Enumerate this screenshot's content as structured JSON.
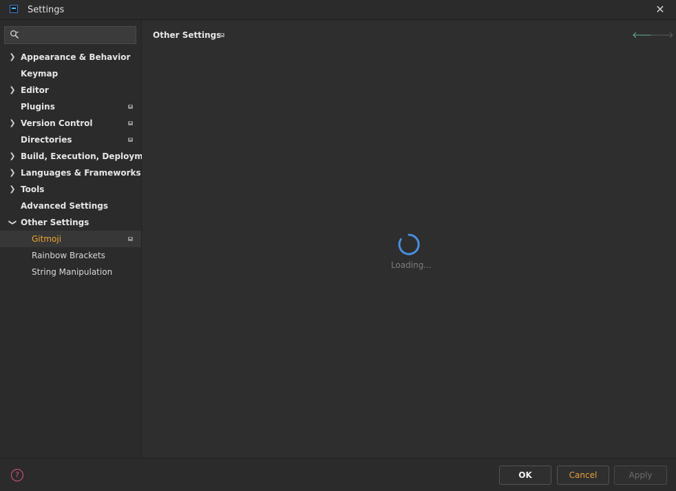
{
  "window": {
    "title": "Settings"
  },
  "search": {
    "placeholder": "",
    "value": ""
  },
  "sidebar": {
    "items": [
      {
        "label": "Appearance & Behavior",
        "expandable": true,
        "expanded": false,
        "badge": false,
        "level": 0
      },
      {
        "label": "Keymap",
        "expandable": false,
        "badge": false,
        "level": 0
      },
      {
        "label": "Editor",
        "expandable": true,
        "expanded": false,
        "badge": false,
        "level": 0
      },
      {
        "label": "Plugins",
        "expandable": false,
        "badge": true,
        "level": 0
      },
      {
        "label": "Version Control",
        "expandable": true,
        "expanded": false,
        "badge": true,
        "level": 0
      },
      {
        "label": "Directories",
        "expandable": false,
        "badge": true,
        "level": 0
      },
      {
        "label": "Build, Execution, Deployment",
        "expandable": true,
        "expanded": false,
        "badge": false,
        "level": 0
      },
      {
        "label": "Languages & Frameworks",
        "expandable": true,
        "expanded": false,
        "badge": false,
        "level": 0
      },
      {
        "label": "Tools",
        "expandable": true,
        "expanded": false,
        "badge": false,
        "level": 0
      },
      {
        "label": "Advanced Settings",
        "expandable": false,
        "badge": false,
        "level": 0
      },
      {
        "label": "Other Settings",
        "expandable": true,
        "expanded": true,
        "badge": false,
        "level": 0
      },
      {
        "label": "Gitmoji",
        "expandable": false,
        "badge": true,
        "level": 1,
        "selected": true
      },
      {
        "label": "Rainbow Brackets",
        "expandable": false,
        "badge": false,
        "level": 1
      },
      {
        "label": "String Manipulation",
        "expandable": false,
        "badge": false,
        "level": 1
      }
    ]
  },
  "main": {
    "breadcrumb": "Other Settings",
    "loading_text": "Loading..."
  },
  "footer": {
    "ok_label": "OK",
    "cancel_label": "Cancel",
    "apply_label": "Apply",
    "help_glyph": "?"
  },
  "colors": {
    "accent_selected": "#f0a732",
    "cancel_text": "#e8a23a",
    "spinner": "#4a8fe0",
    "nav_back": "#5fb3a1",
    "help": "#e0557a"
  }
}
